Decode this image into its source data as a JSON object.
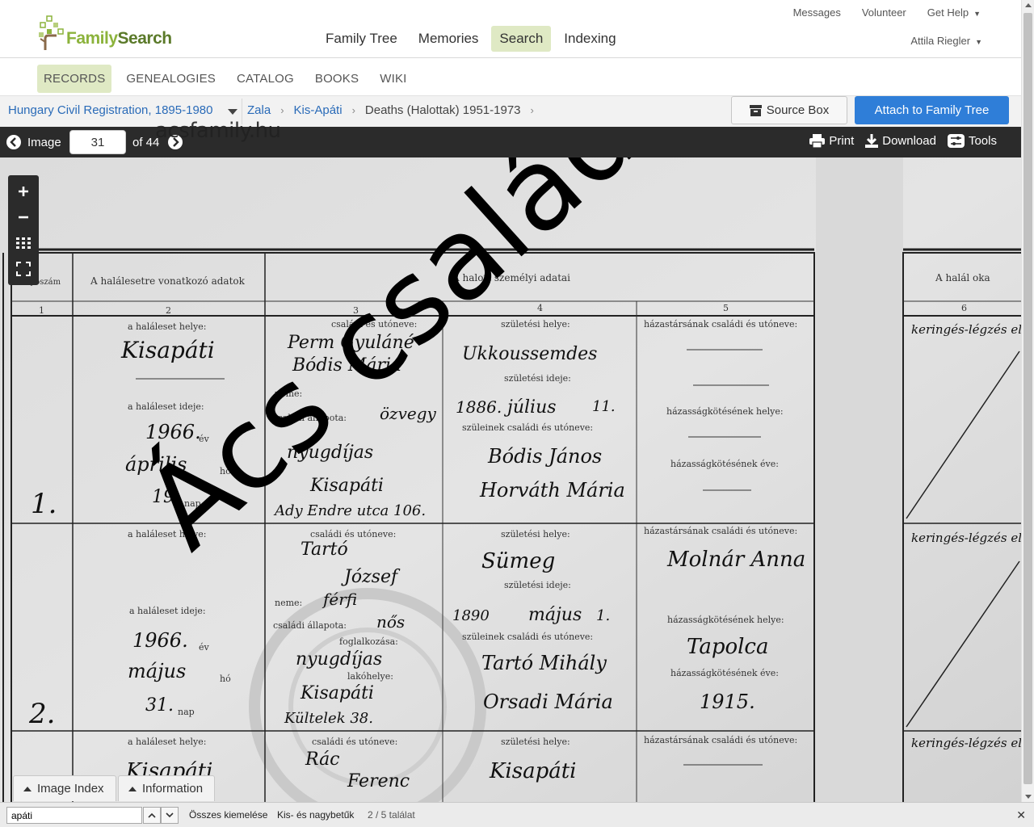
{
  "logo": {
    "text_part1": "Family",
    "text_part2": "Search"
  },
  "main_nav": [
    {
      "label": "Family Tree",
      "active": false
    },
    {
      "label": "Memories",
      "active": false
    },
    {
      "label": "Search",
      "active": true
    },
    {
      "label": "Indexing",
      "active": false
    }
  ],
  "util_nav": {
    "messages": "Messages",
    "volunteer": "Volunteer",
    "help": "Get Help",
    "user": "Attila Riegler"
  },
  "sub_nav": [
    {
      "label": "RECORDS",
      "active": true
    },
    {
      "label": "GENEALOGIES",
      "active": false
    },
    {
      "label": "CATALOG",
      "active": false
    },
    {
      "label": "BOOKS",
      "active": false
    },
    {
      "label": "WIKI",
      "active": false
    }
  ],
  "breadcrumb": {
    "collection": "Hungary Civil Registration, 1895-1980",
    "items": [
      "Zala",
      "Kis-Apáti",
      "Deaths (Halottak) 1951-1973"
    ]
  },
  "buttons": {
    "source_box": "Source Box",
    "attach": "Attach to Family Tree"
  },
  "image_bar": {
    "image_label": "Image",
    "current": "31",
    "of_label": "of 44",
    "print": "Print",
    "download": "Download",
    "tools": "Tools"
  },
  "overlay_text": {
    "site": "acsfamily.hu",
    "watermark": "Ács család"
  },
  "bottom_tabs": {
    "index": "Image Index",
    "info": "Information"
  },
  "find_bar": {
    "query": "apáti",
    "highlight_all": "Összes kiemelése",
    "match_case": "Kis- és nagybetűk",
    "result": "2 / 5 találat"
  },
  "document": {
    "header_col1": "Folyószám",
    "header_col2": "A halálesetre vonatkozó adatok",
    "header_col3": "A halott személyi adatai",
    "header_col6": "A halál oka",
    "col_nums": [
      "1",
      "2",
      "3",
      "4",
      "5",
      "6"
    ],
    "labels": {
      "place": "a haláleset helye:",
      "date": "a haláleset ideje:",
      "name": "családi és utóneve:",
      "birthplace": "születési helye:",
      "birthdate": "születési ideje:",
      "parents": "szüleinek családi és utóneve:",
      "spouse": "házastársának családi és utóneve:",
      "marriage_place": "házasságkötésének helye:",
      "marriage_year": "házasságkötésének éve:",
      "neme": "neme:",
      "status": "családi állapota:",
      "occupation": "foglalkozása:",
      "residence": "lakóhelye:",
      "ev": "év",
      "ho": "hó",
      "nap": "nap"
    },
    "rows": [
      {
        "num": "1.",
        "place": "Kisapáti",
        "year": "1966.",
        "month": "április",
        "day": "19.",
        "name1": "Perm Gyuláné",
        "name2": "Bódis Mária",
        "status": "özvegy",
        "occupation": "nyugdíjas",
        "residence": "Kisapáti",
        "street": "Ady Endre utca 106.",
        "birthplace": "Ukkoussemdes",
        "birthyear": "1886.",
        "birthmonth": "július",
        "birthday": "11.",
        "father": "Bódis János",
        "mother": "Horváth Mária",
        "spouse": "",
        "cause": "keringés-légzés elégtelenség"
      },
      {
        "num": "2.",
        "place": "Kisapáti",
        "year": "1966.",
        "month": "május",
        "day": "31.",
        "name1": "Tartó",
        "name2": "József",
        "gender": "férfi",
        "status": "nős",
        "occupation": "nyugdíjas",
        "residence": "Kisapáti",
        "street": "Kültelek 38.",
        "birthplace": "Sümeg",
        "birthyear": "1890",
        "birthmonth": "május",
        "birthday": "1.",
        "father": "Tartó Mihály",
        "mother": "Orsadi Mária",
        "spouse": "Molnár Anna",
        "marriage_place": "Tapolca",
        "marriage_year": "1915.",
        "cause": "keringés-légzés elégtelenség"
      },
      {
        "num": "",
        "place": "Kisapáti",
        "name1": "Rác",
        "name2": "Ferenc",
        "birthplace": "Kisapáti",
        "cause": "keringés-légzés elégtelenség"
      }
    ]
  },
  "colors": {
    "accent_green": "#dfe9c4",
    "link_blue": "#2a6bb8",
    "button_blue": "#2f7ed8",
    "toolbar_dark": "#2b2b2b"
  }
}
